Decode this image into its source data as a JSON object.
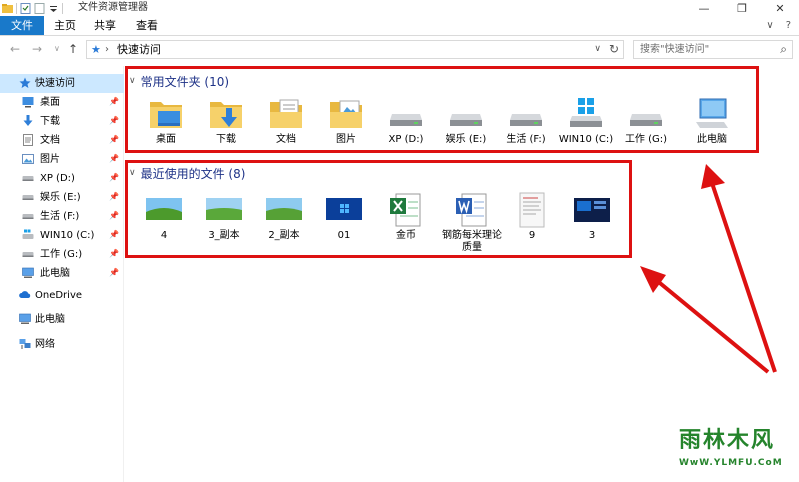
{
  "window": {
    "title": "文件资源管理器",
    "controls": [
      "—",
      "❐",
      "✕"
    ]
  },
  "ribbon": {
    "tabs": [
      "文件",
      "主页",
      "共享",
      "查看"
    ],
    "right": [
      "∨",
      "?"
    ]
  },
  "address": {
    "path": "快速访问",
    "search_placeholder": "搜索\"快速访问\""
  },
  "sidebar": {
    "quick_access": "快速访问",
    "items": [
      {
        "label": "桌面",
        "icon": "desktop-icon"
      },
      {
        "label": "下载",
        "icon": "download-icon"
      },
      {
        "label": "文档",
        "icon": "document-icon"
      },
      {
        "label": "图片",
        "icon": "pictures-icon"
      },
      {
        "label": "XP (D:)",
        "icon": "drive-icon"
      },
      {
        "label": "娱乐 (E:)",
        "icon": "drive-icon"
      },
      {
        "label": "生活 (F:)",
        "icon": "drive-icon"
      },
      {
        "label": "WIN10 (C:)",
        "icon": "windows-drive-icon"
      },
      {
        "label": "工作 (G:)",
        "icon": "drive-icon"
      },
      {
        "label": "此电脑",
        "icon": "computer-icon"
      }
    ],
    "onedrive": "OneDrive",
    "this_pc": "此电脑",
    "network": "网络"
  },
  "frequent": {
    "header": "常用文件夹 (10)",
    "items": [
      {
        "label": "桌面",
        "icon": "desktop-folder-icon"
      },
      {
        "label": "下载",
        "icon": "download-folder-icon"
      },
      {
        "label": "文档",
        "icon": "document-folder-icon"
      },
      {
        "label": "图片",
        "icon": "pictures-folder-icon"
      },
      {
        "label": "XP (D:)",
        "icon": "drive-icon"
      },
      {
        "label": "娱乐 (E:)",
        "icon": "drive-icon"
      },
      {
        "label": "生活 (F:)",
        "icon": "drive-icon"
      },
      {
        "label": "WIN10 (C:)",
        "icon": "windows-drive-icon"
      },
      {
        "label": "工作 (G:)",
        "icon": "drive-icon"
      },
      {
        "label": "此电脑",
        "icon": "computer-icon"
      }
    ]
  },
  "recent": {
    "header": "最近使用的文件 (8)",
    "items": [
      {
        "label": "4",
        "icon": "image-thumbnail-icon"
      },
      {
        "label": "3_副本",
        "icon": "image-thumbnail-icon"
      },
      {
        "label": "2_副本",
        "icon": "image-thumbnail-icon"
      },
      {
        "label": "01",
        "icon": "image-thumbnail-icon"
      },
      {
        "label": "金币",
        "icon": "excel-file-icon"
      },
      {
        "label": "钢筋每米理论质量",
        "icon": "word-file-icon"
      },
      {
        "label": "9",
        "icon": "document-thumbnail-icon"
      },
      {
        "label": "3",
        "icon": "screenshot-thumbnail-icon"
      }
    ]
  },
  "watermark": {
    "name": "雨林木风",
    "url": "WwW.YLMFU.CoM"
  },
  "colors": {
    "file_tab": "#1979ca",
    "selected": "#cce8ff",
    "group_header": "#1e3287",
    "annotation": "#dd1111"
  }
}
